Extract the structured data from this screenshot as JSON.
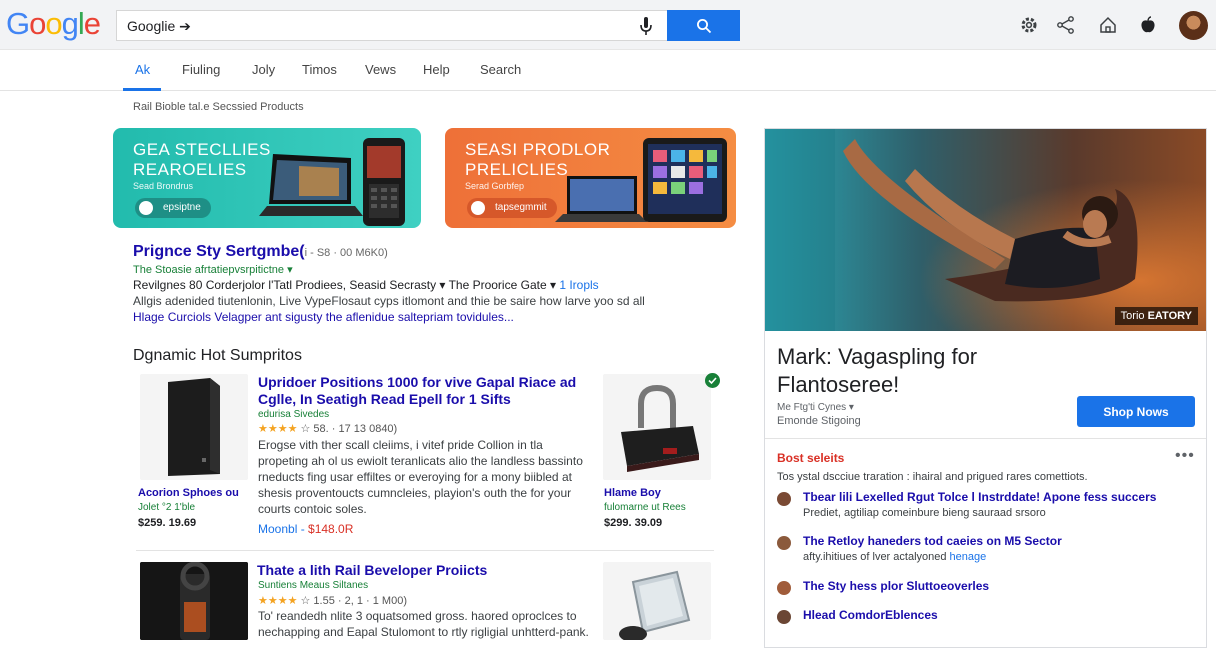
{
  "header": {
    "logo": "Google",
    "search_value": "Googlie ➔",
    "colors": {
      "search_button": "#1a73e8",
      "logo_blue": "#4285f4",
      "logo_red": "#ea4335",
      "logo_yellow": "#fbbc05",
      "logo_green": "#34a853"
    }
  },
  "tabs": [
    {
      "label": "Ak",
      "active": true
    },
    {
      "label": "Fiuling"
    },
    {
      "label": "Joly"
    },
    {
      "label": "Timos"
    },
    {
      "label": "Vews"
    },
    {
      "label": "Help"
    },
    {
      "label": "Search"
    }
  ],
  "breadcrumb": "Rail Bioble tal.e Secssied Products",
  "promos": [
    {
      "title_line1": "GEA STECLLIES",
      "title_line2": "REAROELIES",
      "sub": "Sead Brondrus",
      "chip": "epsiptne",
      "color": "#21b9aa"
    },
    {
      "title_line1": "SEASI PRODLOR",
      "title_line2": "PRELICLIES",
      "sub": "Serad Gorbfep",
      "chip": "tapsegmmit",
      "color": "#ef7a3a"
    }
  ],
  "result": {
    "title": "Prignce Sty Sertgmbe(",
    "meta": "i - S8 · 00 M6K0)",
    "url": "The Stoasie afrtatiepvsrpitictne ▾",
    "line": "Revilgnes 80 Corderjolor l'Tatl Prodiees, Seasid Secrasty ▾ The Proorice Gate ▾",
    "line_link": "1 Iropls",
    "desc1": "Allgis adenided tiutenlonin, Live VypeFlosaut cyps itlomont and thie be saire how larve yoo sd all",
    "desc2": "Hlage Curciols Velagper ant sigusty the aflenidue saltepriam tovidules..."
  },
  "section_title": "Dgnamic Hot Sumpritos",
  "cards": [
    {
      "title_line1": "Upridoer Positions 1000 for vive Gapal Riace ad",
      "title_line2": "Cglle, In Seatigh Read Epell for 1 Sifts",
      "seller": "edurisa Sivedes",
      "stars": "★★★★",
      "rating": "☆ 58.  · 17 13 0840)",
      "desc": [
        "Erogse vith ther scall cleiims, i vitef pride Collion in tla",
        "propeting ah ol us ewiolt teranlicats alio the landless bassinto",
        "rneducts fing usar effiltes or everoying for a mony biibled at",
        "shesis proventoucts cumncleies, playion's outh the for your",
        "courts contoic soles."
      ],
      "price_a": "Moonbl -",
      "price_b": "$148.0R",
      "left_name": "Acorion Sphoes ou",
      "left_seller": "Jolet °2 1'ble",
      "left_price": "$259. 19.69",
      "right_name": "Hlame Boy",
      "right_seller": "fulomarne ut Rees",
      "right_price": "$299. 39.09"
    },
    {
      "title_line1": "Thate a lith Rail Beveloper Proiicts",
      "seller": "Suntiens Meaus Siltanes",
      "stars": "★★★★",
      "rating": "☆ 1.55 · 2, 1 · 1 M00)",
      "desc": [
        "To' reandedh nlite 3 oquatsomed gross. haored oproclces to",
        "nechapping and Eapal Stulomont to rtly rigligial unhtterd-pank."
      ]
    }
  ],
  "panel": {
    "tag_pre": "Torio",
    "tag_bold": "EATORY",
    "title": "Mark: Vagaspling for Flantoseree!",
    "sub1": "Me Ftg'ti Cynes ▾",
    "sub2": "Emonde Stigoing",
    "shop_label": "Shop Nows",
    "best_title": "Bost seleits",
    "more": "•••",
    "best_desc": "Tos ystal dscciue traration : ihairal and prigued rares comettiots.",
    "items": [
      {
        "title": "Tbear lili Lexelled Rgut Tolce l Instrddate! Apone fess succers",
        "sub": "Prediet, agtiliap comeinbure bieng sauraad srsoro",
        "color": "#7a4a34"
      },
      {
        "title": "The Retloy haneders tod caeies on M5 Sector",
        "sub": "afty.ihitiues of lver actalyoned",
        "sub_link": "henage",
        "color": "#8b5a3c"
      },
      {
        "title": "The Sty hess plor Sluttoeoverles",
        "color": "#a05c3a"
      },
      {
        "title": "Hlead ComdorEblences",
        "color": "#6b4634"
      }
    ]
  }
}
